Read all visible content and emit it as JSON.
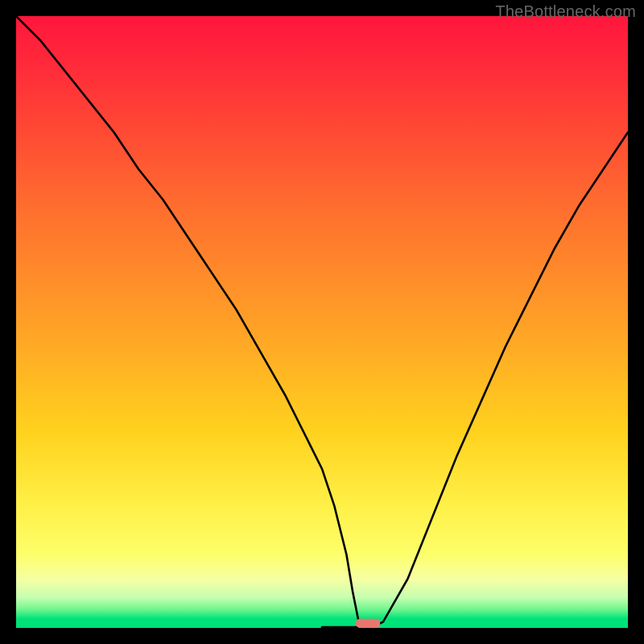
{
  "watermark": "TheBottleneck.com",
  "chart_data": {
    "type": "line",
    "title": "",
    "xlabel": "",
    "ylabel": "",
    "xlim": [
      0,
      100
    ],
    "ylim": [
      0,
      100
    ],
    "grid": false,
    "background": "rainbow-gradient-red-to-green",
    "series": [
      {
        "name": "bottleneck-curve",
        "x": [
          0,
          4,
          8,
          12,
          16,
          20,
          24,
          28,
          32,
          36,
          40,
          44,
          48,
          50,
          52,
          54,
          55,
          56,
          57,
          58,
          60,
          64,
          68,
          72,
          76,
          80,
          84,
          88,
          92,
          96,
          100
        ],
        "y": [
          100,
          96,
          91,
          86,
          81,
          75,
          70,
          64,
          58,
          52,
          45,
          38,
          30,
          26,
          20,
          12,
          6,
          1,
          0,
          0,
          1,
          8,
          18,
          28,
          37,
          46,
          54,
          62,
          69,
          75,
          81
        ]
      }
    ],
    "optimal_marker": {
      "x": 57.5,
      "y": 0,
      "width": 4,
      "height": 1.5,
      "color": "#e8766f"
    },
    "flat_bottom_range": [
      50,
      56
    ]
  }
}
